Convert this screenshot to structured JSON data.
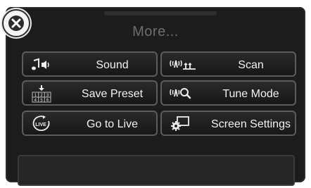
{
  "window": {
    "title": "More..."
  },
  "buttons": {
    "sound": "Sound",
    "scan": "Scan",
    "save_preset": "Save Preset",
    "tune_mode": "Tune Mode",
    "go_to_live": "Go to Live",
    "screen_settings": "Screen Settings"
  },
  "icons": {
    "live_text": "LIVE",
    "preset_digits": [
      "1",
      "2",
      "3",
      "4",
      "5",
      "6"
    ]
  },
  "colors": {
    "panel": "#1c1c1c",
    "button_border": "#5c5c5c",
    "title": "#6d6d6d"
  }
}
